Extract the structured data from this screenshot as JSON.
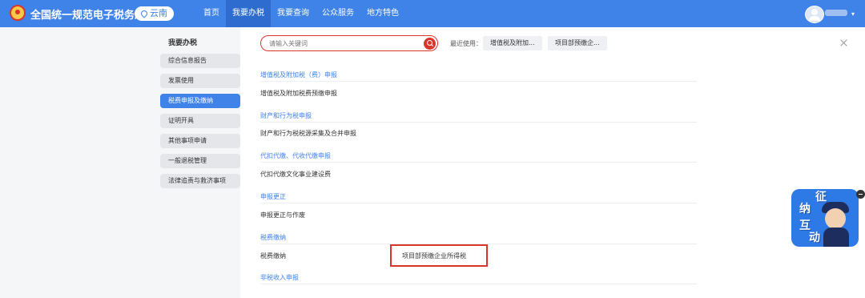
{
  "header": {
    "title": "全国统一规范电子税务局",
    "region": "云南",
    "nav": [
      "首页",
      "我要办税",
      "我要查询",
      "公众服务",
      "地方特色"
    ],
    "active_nav_index": 1
  },
  "sidebar": {
    "title": "我要办税",
    "items": [
      {
        "label": "综合信息报告"
      },
      {
        "label": "发票使用"
      },
      {
        "label": "税费申报及缴纳"
      },
      {
        "label": "证明开具"
      },
      {
        "label": "其他事项申请"
      },
      {
        "label": "一般退税管理"
      },
      {
        "label": "法律追责与救济事项"
      }
    ],
    "active_index": 2
  },
  "search": {
    "placeholder": "请输入关键词"
  },
  "recent": {
    "label": "最近使用：",
    "items": [
      "增值税及附加...",
      "项目部预缴企..."
    ]
  },
  "categories": [
    {
      "header": "增值税及附加税（费）申报",
      "items": [
        "增值税及附加税费预缴申报"
      ]
    },
    {
      "header": "财产和行为税申报",
      "items": [
        "财产和行为税税源采集及合并申报"
      ]
    },
    {
      "header": "代扣代缴、代收代缴申报",
      "items": [
        "代扣代缴文化事业建设费"
      ]
    },
    {
      "header": "申报更正",
      "items": [
        "申报更正与作废"
      ]
    },
    {
      "header": "税费缴纳",
      "items": [
        "税费缴纳",
        "项目部预缴企业所得税"
      ]
    },
    {
      "header": "非税收入申报",
      "items": []
    }
  ],
  "widget": {
    "chars": [
      "征",
      "纳",
      "互",
      "动"
    ]
  },
  "colors": {
    "primary": "#3f82e8",
    "highlight": "#d9362b"
  }
}
